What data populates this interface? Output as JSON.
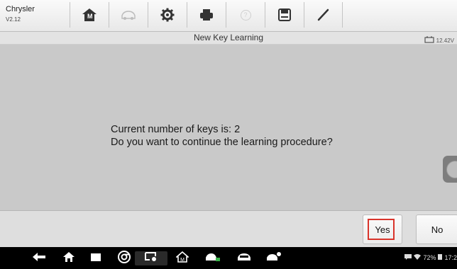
{
  "app": {
    "make": "Chrysler",
    "version": "V2.12"
  },
  "toolbar": {
    "tools": [
      {
        "icon": "home-icon",
        "label_letter": "M"
      },
      {
        "icon": "vehicle-swap-icon"
      },
      {
        "icon": "gear-icon"
      },
      {
        "icon": "printer-icon"
      },
      {
        "icon": "help-icon",
        "glyph": "?"
      },
      {
        "icon": "save-icon"
      },
      {
        "icon": "pen-icon"
      }
    ]
  },
  "titlebar": {
    "title": "New Key Learning",
    "battery_voltage": "12.42V"
  },
  "dialog": {
    "line1": "Current number of keys is: 2",
    "line2": "Do you want to continue the learning procedure?"
  },
  "actions": {
    "yes_label": "Yes",
    "no_label": "No",
    "highlight_color": "#d9342b"
  },
  "system_bar": {
    "icons": [
      "back-icon",
      "home-icon",
      "recent-apps-icon",
      "chrome-icon",
      "screen-record-icon",
      "autel-home-icon",
      "car-service-icon",
      "car-icon",
      "car-user-icon"
    ],
    "battery_percent": "72%",
    "clock": "17:2"
  },
  "colors": {
    "background": "#c9c9c9",
    "toolbar": "#f2f2f2",
    "navbar": "#000000",
    "accent_red": "#d9342b"
  }
}
